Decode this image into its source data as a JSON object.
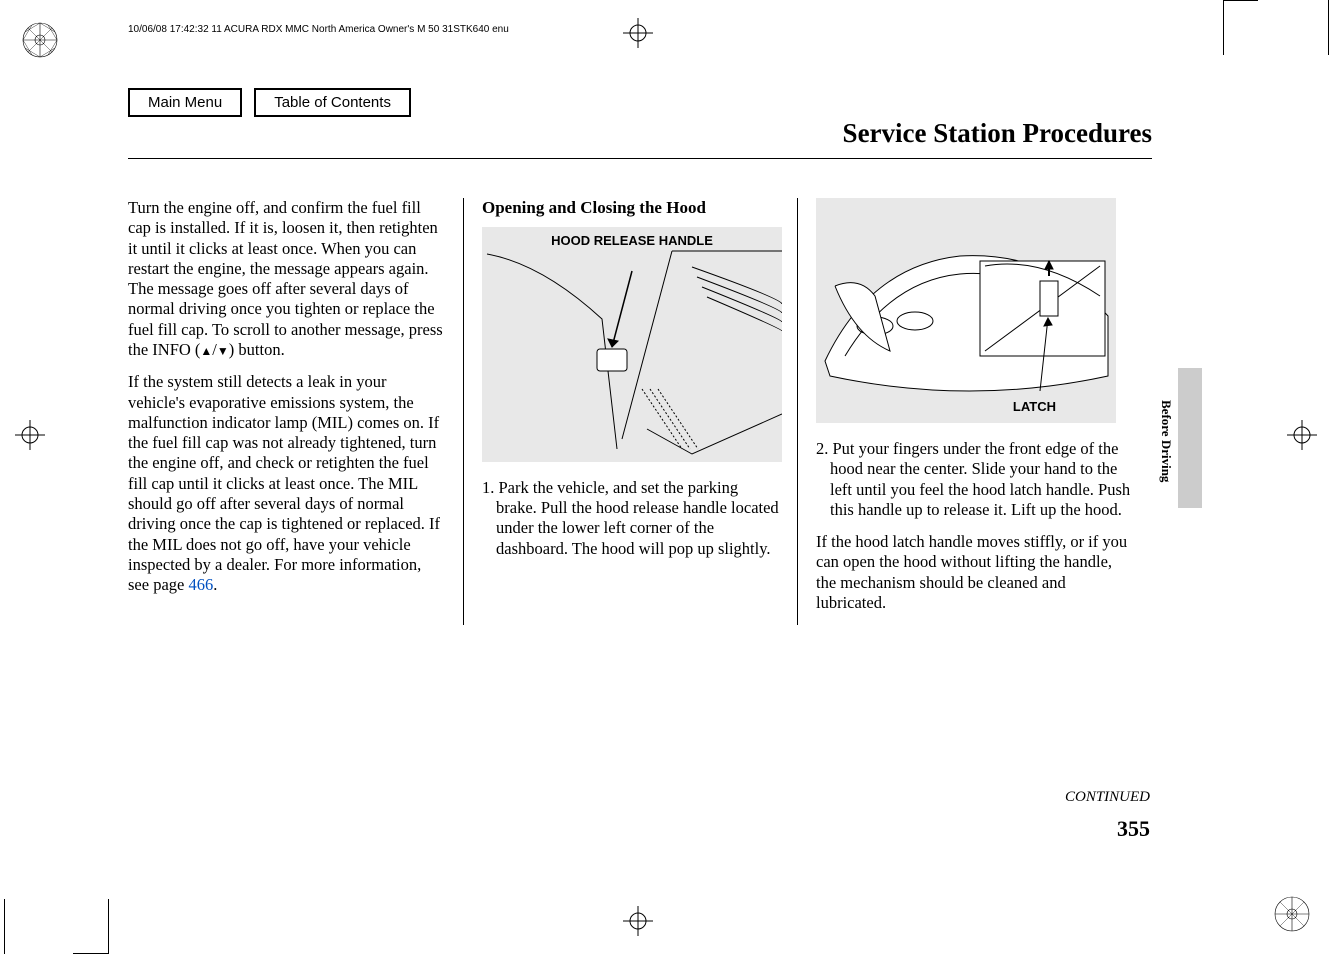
{
  "header": "10/06/08 17:42:32    11 ACURA RDX MMC North America Owner's M 50 31STK640 enu",
  "nav": {
    "main_menu": "Main Menu",
    "toc": "Table of Contents"
  },
  "title": "Service Station Procedures",
  "side_label": "Before Driving",
  "col1": {
    "p1a": "Turn the engine off, and confirm the fuel fill cap is installed. If it is, loosen it, then retighten it until it clicks at least once. When you can restart the engine, the message appears again. The message goes off after several days of normal driving once you tighten or replace the fuel fill cap. To scroll to another message, press the INFO (",
    "p1b": ") button.",
    "p2a": "If the system still detects a leak in your vehicle's evaporative emissions system, the malfunction indicator lamp (MIL) comes on. If the fuel fill cap was not already tightened, turn the engine off, and check or retighten the fuel fill cap until it clicks at least once. The MIL should go off after several days of normal driving once the cap is tightened or replaced. If the MIL does not go off, have your vehicle inspected by a dealer. For more information, see page ",
    "page_ref": "466",
    "p2b": "."
  },
  "col2": {
    "heading": "Opening and Closing the Hood",
    "fig_label": "HOOD RELEASE HANDLE",
    "step1": "1. Park the vehicle, and set the parking brake. Pull the hood release handle located under the lower left corner of the dashboard. The hood will pop up slightly."
  },
  "col3": {
    "fig_label": "LATCH",
    "step2": "2. Put your fingers under the front edge of the hood near the center. Slide your hand to the left until you feel the hood latch handle. Push this handle up to release it. Lift up the hood.",
    "p2": "If the hood latch handle moves stiffly, or if you can open the hood without lifting the handle, the mechanism should be cleaned and lubricated."
  },
  "continued": "CONTINUED",
  "page_number": "355"
}
